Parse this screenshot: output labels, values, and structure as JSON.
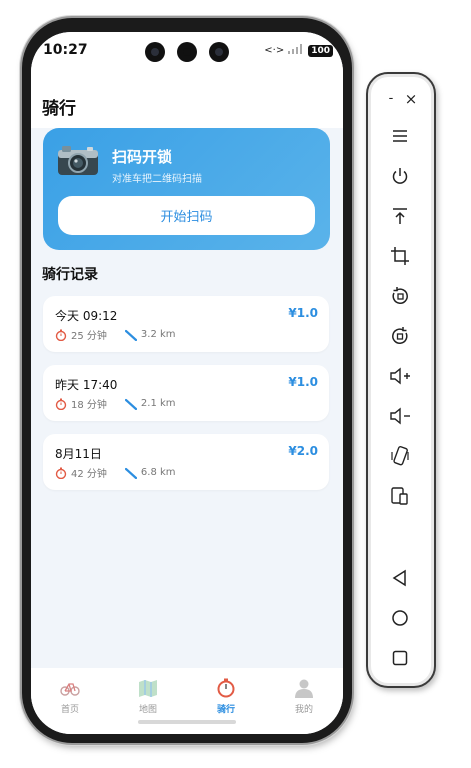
{
  "status_bar": {
    "time": "10:27",
    "battery": "100"
  },
  "page": {
    "title": "骑行"
  },
  "scan_card": {
    "title": "扫码开锁",
    "subtitle": "对准车把二维码扫描",
    "button_label": "开始扫码"
  },
  "records_section": {
    "title": "骑行记录"
  },
  "records": [
    {
      "date": "今天 09:12",
      "price": "¥1.0",
      "duration": "25 分钟",
      "distance": "3.2 km"
    },
    {
      "date": "昨天 17:40",
      "price": "¥1.0",
      "duration": "18 分钟",
      "distance": "2.1 km"
    },
    {
      "date": "8月11日",
      "price": "¥2.0",
      "duration": "42 分钟",
      "distance": "6.8 km"
    }
  ],
  "tabs": [
    {
      "label": "首页",
      "icon": "bicycle-icon",
      "active": false
    },
    {
      "label": "地图",
      "icon": "map-icon",
      "active": false
    },
    {
      "label": "骑行",
      "icon": "stopwatch-icon",
      "active": true
    },
    {
      "label": "我的",
      "icon": "person-icon",
      "active": false
    }
  ],
  "toolbar": {
    "minimize": "-",
    "close": "×",
    "buttons": [
      "menu-icon",
      "power-icon",
      "pin-top-icon",
      "crop-icon",
      "rotate-icon",
      "screen-rotate-icon",
      "volume-up-icon",
      "volume-down-icon",
      "shake-icon",
      "device-icon",
      "back-icon",
      "home-icon",
      "overview-icon"
    ]
  },
  "colors": {
    "accent": "#2c8ee0",
    "card_gradient_start": "#3aa0e6",
    "card_gradient_end": "#5ab3ea",
    "background": "#f1f5fa"
  }
}
